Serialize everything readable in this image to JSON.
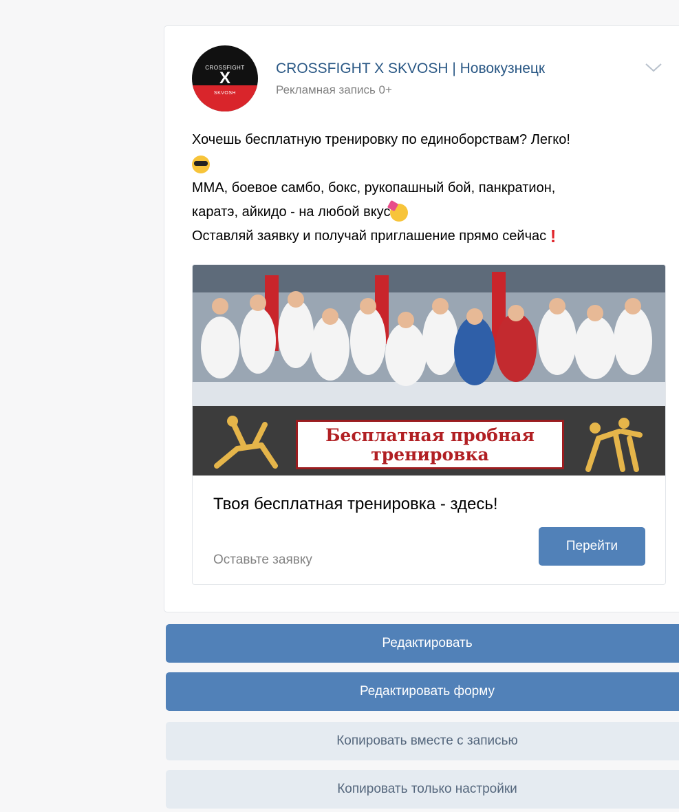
{
  "post": {
    "author": {
      "name": "CROSSFIGHT X SKVOSH | Новокузнецк",
      "ad_label": "Рекламная запись 0+",
      "avatar_text_top": "CROSSFIGHT",
      "avatar_text_mid": "X",
      "avatar_text_bottom": "SKVOSH"
    },
    "text_lines": [
      "Хочешь бесплатную тренировку по единоборствам? Легко!",
      "МMA, боевое самбо, бокс, рукопашный бой, панкратион,",
      "каратэ, айкидо - на любой вкус",
      "Оставляй заявку и получай приглашение прямо сейчас"
    ],
    "emojis": {
      "line1": "cool-sunglasses-emoji",
      "line3": "party-face-emoji",
      "line4": "exclamation-emoji"
    },
    "attachment": {
      "banner_line1": "Бесплатная пробная",
      "banner_line2": "тренировка",
      "title": "Твоя бесплатная тренировка - здесь!",
      "subtitle": "Оставьте заявку",
      "button_label": "Перейти"
    }
  },
  "actions": {
    "edit": "Редактировать",
    "edit_form": "Редактировать форму",
    "copy_with_post": "Копировать вместе с записью",
    "copy_settings": "Копировать только настройки"
  },
  "colors": {
    "accent": "#5181b8",
    "link": "#2a5885",
    "muted": "#828282",
    "secondary_bg": "#e5ebf1",
    "banner_red": "#b11f23"
  }
}
